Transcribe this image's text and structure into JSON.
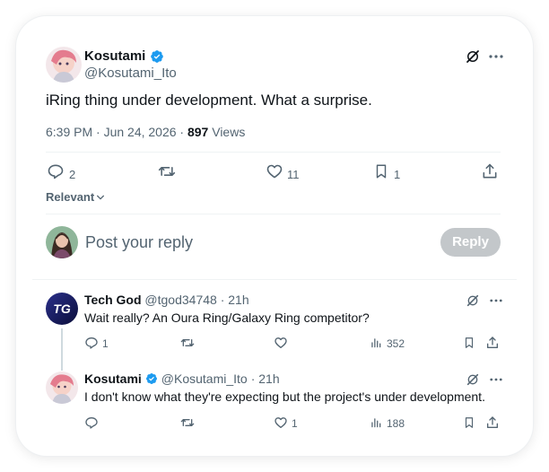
{
  "main_post": {
    "author_name": "Kosutami",
    "author_handle": "@Kosutami_Ito",
    "text": "iRing thing under development. What a surprise.",
    "time": "6:39 PM · Jun 24, 2026 · ",
    "views_count": "897",
    "views_label": " Views",
    "replies": "2",
    "likes": "11",
    "bookmarks": "1"
  },
  "sort": {
    "label": "Relevant"
  },
  "composer": {
    "placeholder": "Post your reply",
    "button_label": "Reply"
  },
  "replies": [
    {
      "author_name": "Tech God",
      "author_handle": "@tgod34748",
      "time": "· 21h",
      "text": "Wait really? An Oura Ring/Galaxy Ring competitor?",
      "replies": "1",
      "likes": "",
      "views": "352",
      "avatar_text": "TG"
    },
    {
      "author_name": "Kosutami",
      "author_handle": "@Kosutami_Ito",
      "time": "· 21h",
      "text": "I don't know what they're expecting but the project's under development.",
      "replies": "",
      "likes": "1",
      "views": "188"
    }
  ],
  "colors": {
    "verified": "#1d9bf0",
    "text_primary": "#0f1419",
    "text_secondary": "#536471",
    "reply_button_disabled": "#c3c7ca"
  },
  "icons": {
    "grok": "grok-icon",
    "more": "more-icon",
    "reply": "reply-icon",
    "repost": "repost-icon",
    "like": "like-icon",
    "bookmark": "bookmark-icon",
    "share": "share-icon",
    "views": "views-icon",
    "verified": "verified-badge-icon",
    "chevron": "chevron-down-icon"
  }
}
